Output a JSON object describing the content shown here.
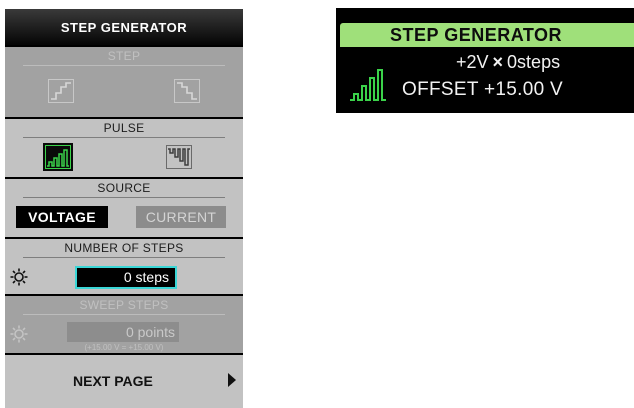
{
  "panel": {
    "title": "STEP GENERATOR",
    "step": {
      "title": "STEP",
      "enabled": false,
      "icons": [
        "staircase-up-icon",
        "staircase-down-icon"
      ]
    },
    "pulse": {
      "title": "PULSE",
      "selected": "pulse-up",
      "icons": [
        "pulse-up-icon",
        "pulse-down-icon"
      ]
    },
    "source": {
      "title": "SOURCE",
      "voltage_label": "VOLTAGE",
      "current_label": "CURRENT",
      "selected": "VOLTAGE"
    },
    "num_steps": {
      "title": "NUMBER OF STEPS",
      "value": "0 steps",
      "icon": "sun-icon"
    },
    "sweep_steps": {
      "title": "SWEEP STEPS",
      "value": "0 points",
      "range": "(+15.00 V = +15.00 V)",
      "enabled": false,
      "icon": "sun-icon"
    },
    "next_page_label": "NEXT PAGE"
  },
  "readout": {
    "title": "STEP GENERATOR",
    "step_size": "+2V",
    "times": "×",
    "steps": "0steps",
    "offset_label": "OFFSET",
    "offset_value": "+15.00 V",
    "icon": "pulse-up-icon"
  },
  "colors": {
    "header_bg": "#000000",
    "section_bg": "#c2c2c2",
    "selected_accent": "#3aa85a",
    "field_border": "#3ad6d6",
    "readout_header": "#9fe07a",
    "pulse_icon_green": "#3bd24a"
  }
}
